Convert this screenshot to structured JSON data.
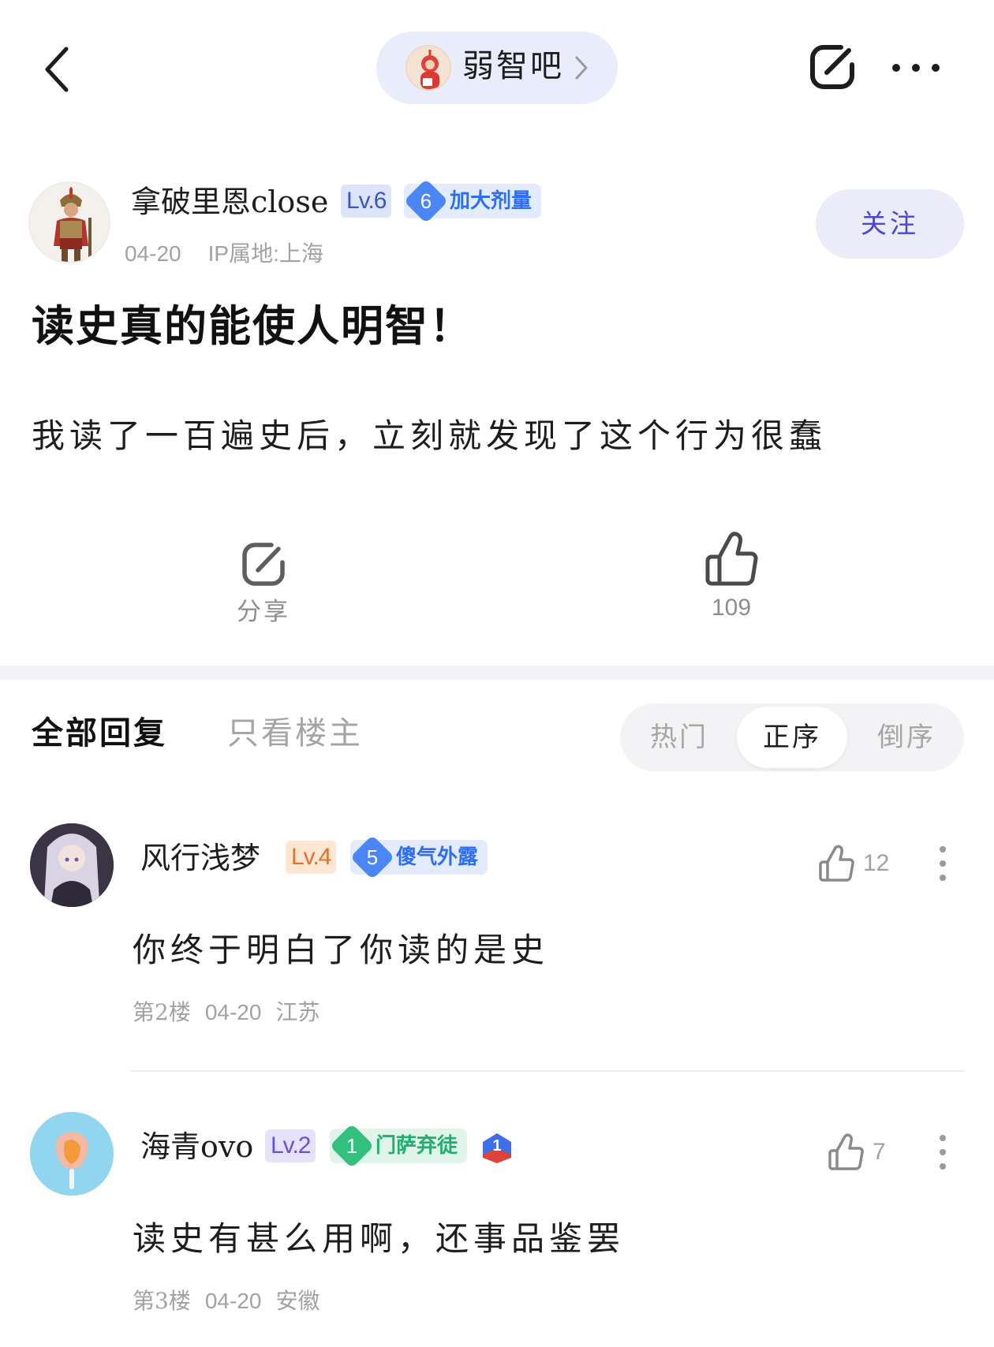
{
  "topbar": {
    "forum_name": "弱智吧",
    "icons": [
      "back-icon",
      "forum-avatar",
      "chevron-right-icon",
      "share-icon",
      "more-icon"
    ]
  },
  "author": {
    "name": "拿破里恩close",
    "level": "Lv.6",
    "badge_level": "6",
    "badge_title": "加大剂量",
    "date": "04-20",
    "ip": "IP属地:上海",
    "follow_label": "关注"
  },
  "post": {
    "title": "读史真的能使人明智！",
    "body": "我读了一百遍史后，立刻就发现了这个行为很蠢"
  },
  "actions": {
    "share_label": "分享",
    "like_count": "109"
  },
  "tabs": {
    "all": "全部回复",
    "op_only": "只看楼主",
    "sort": [
      "热门",
      "正序",
      "倒序"
    ],
    "sort_selected": "正序"
  },
  "comments": [
    {
      "name": "风行浅梦",
      "level": "Lv.4",
      "badge_level": "5",
      "badge_title": "傻气外露",
      "likes": "12",
      "text": "你终于明白了你读的是史",
      "floor": "第2楼",
      "date": "04-20",
      "location": "江苏"
    },
    {
      "name": "海青ovo",
      "level": "Lv.2",
      "badge_level": "1",
      "badge_title": "门萨弃徒",
      "rank_badge": "1",
      "likes": "7",
      "text": "读史有甚么用啊，还事品鉴罢",
      "floor": "第3楼",
      "date": "04-20",
      "location": "安徽"
    }
  ],
  "colors": {
    "accent": "#4b47cc",
    "lv6_badge": "#3c57c5",
    "lv4_badge": "#e0722c",
    "lv2_badge": "#6851d8",
    "title_blue": "#2d6ef5",
    "title_green": "#22ae6e"
  }
}
